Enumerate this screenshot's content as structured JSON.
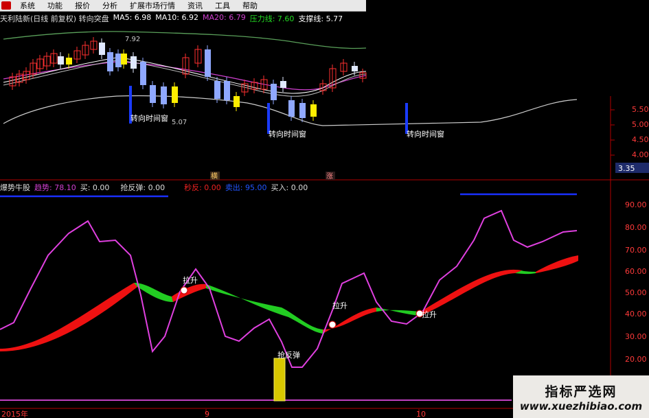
{
  "menu": [
    "系统",
    "功能",
    "报价",
    "分析",
    "扩展市场行情",
    "资讯",
    "工具",
    "帮助"
  ],
  "upper": {
    "title": "天利陆新(日线 前复权) 转向突盘",
    "ma5": "MA5: 6.98",
    "ma10": "MA10: 6.92",
    "ma20": "MA20: 6.79",
    "pressure": "压力线: 7.60",
    "support": "支撑线: 5.77",
    "high_label": "7.92",
    "low_label": "5.07",
    "window_label": "转向时间窗",
    "yticks": [
      "5.50",
      "5.00",
      "4.50",
      "4.00"
    ],
    "price_box": "3.35",
    "tag1": "横",
    "tag2": "涨"
  },
  "lower": {
    "title": "爆势牛股",
    "trend": "趋势: 78.10",
    "buy": "买: 0.00",
    "rebound": "抢反弹: 0.00",
    "second": "秒反: 0.00",
    "sell": "卖出: 95.00",
    "buyin": "买入: 0.00",
    "yticks": [
      "90.00",
      "80.00",
      "70.00",
      "60.00",
      "50.00",
      "40.00",
      "30.00",
      "20.00"
    ],
    "signal_lashen": "拉升",
    "signal_rebound": "抢反弹"
  },
  "xaxis": [
    "2015年",
    "9",
    "10"
  ],
  "watermark": {
    "cn": "指标严选网",
    "url": "www.xuezhibiao.com"
  },
  "colors": {
    "bg": "#000",
    "axis": "#b00000",
    "up": "#ff2a2a",
    "down": "#1a6bff",
    "purple": "#e040e0",
    "green": "#22cc22",
    "red": "#ee1111"
  }
}
